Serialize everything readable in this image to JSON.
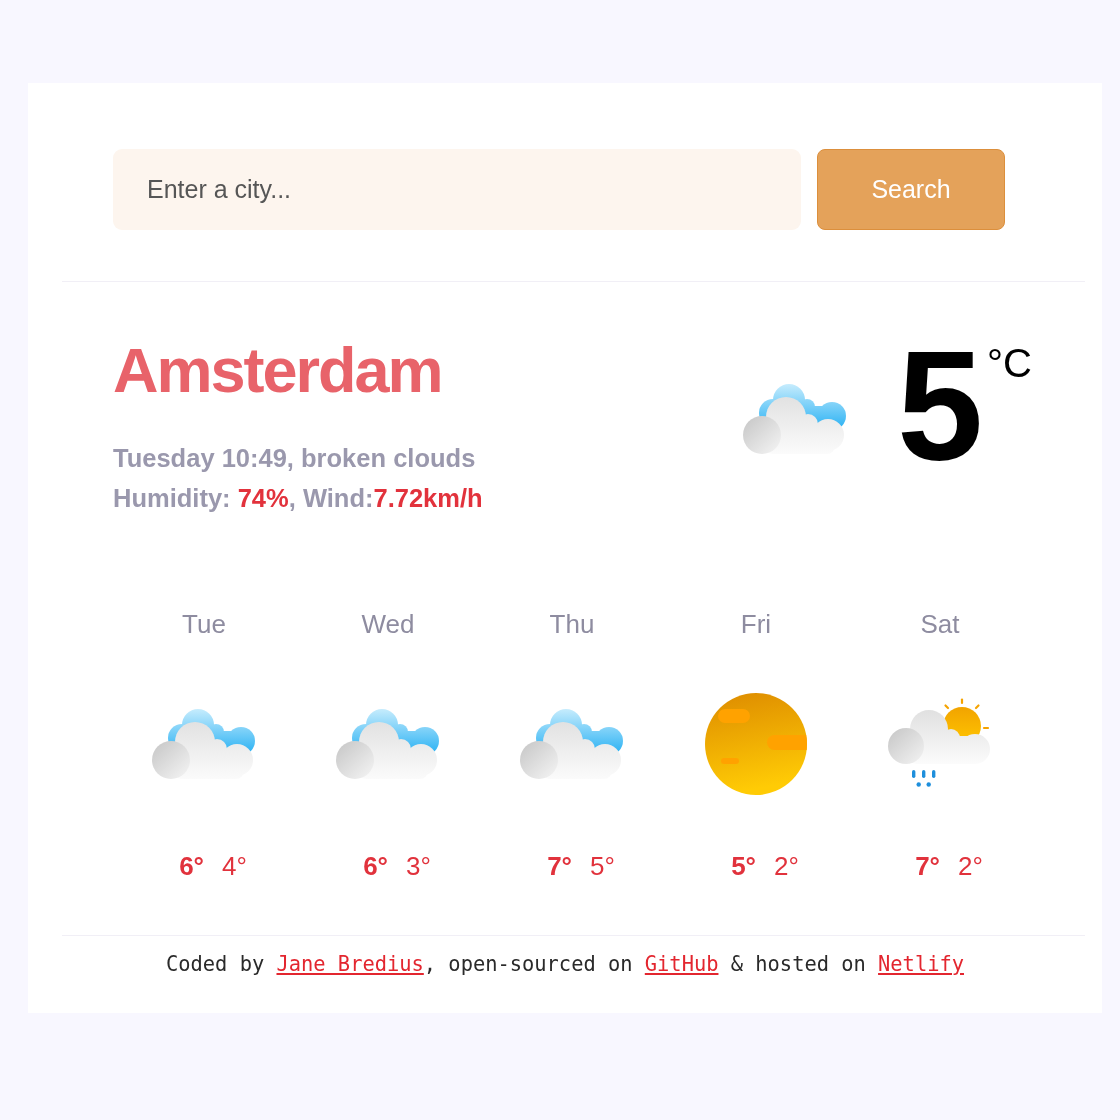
{
  "search": {
    "placeholder": "Enter a city...",
    "button": "Search"
  },
  "current": {
    "city": "Amsterdam",
    "description": "Tuesday 10:49, broken clouds",
    "details": "Humidity: **74%**, Wind:**7.72km/h**",
    "temperature": "5",
    "unit": "°C"
  },
  "forecast": [
    {
      "day": "Tue",
      "kind": "clouds",
      "max": "6°",
      "min": "4°"
    },
    {
      "day": "Wed",
      "kind": "clouds",
      "max": "6°",
      "min": "3°"
    },
    {
      "day": "Thu",
      "kind": "clouds",
      "max": "7°",
      "min": "5°"
    },
    {
      "day": "Fri",
      "kind": "sun",
      "max": "5°",
      "min": "2°"
    },
    {
      "day": "Sat",
      "kind": "rain",
      "max": "7°",
      "min": "2°"
    }
  ],
  "footer": [
    {
      "kind": "text",
      "text": "Coded by "
    },
    {
      "kind": "link",
      "text": "Jane Bredius"
    },
    {
      "kind": "text",
      "text": ", open-sourced on "
    },
    {
      "kind": "link",
      "text": "GitHub"
    },
    {
      "kind": "text",
      "text": " & hosted on "
    },
    {
      "kind": "link",
      "text": "Netlify"
    }
  ]
}
